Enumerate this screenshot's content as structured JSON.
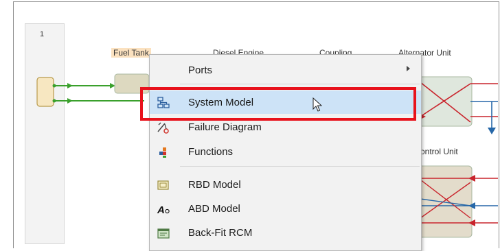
{
  "diagram": {
    "lane_number": "1",
    "blocks": {
      "fuel_tank": "Fuel Tank",
      "diesel_engine": "Diesel Engine",
      "coupling": "Coupling",
      "alternator_unit": "Alternator Unit",
      "control_unit": "ontrol Unit"
    },
    "colors": {
      "green": "#3aa02c",
      "red": "#c9242c",
      "blue": "#2667a8"
    }
  },
  "context_menu": {
    "items": [
      {
        "label": "Ports",
        "icon": "none",
        "has_submenu": true
      },
      {
        "label": "System Model",
        "icon": "system-model-icon",
        "hovered": true
      },
      {
        "label": "Failure Diagram",
        "icon": "failure-diagram-icon"
      },
      {
        "label": "Functions",
        "icon": "functions-icon"
      },
      {
        "label": "RBD Model",
        "icon": "rbd-model-icon"
      },
      {
        "label": "ABD Model",
        "icon": "abd-model-icon"
      },
      {
        "label": "Back-Fit RCM",
        "icon": "back-fit-rcm-icon"
      }
    ]
  },
  "annotation": {
    "highlight_color": "#e8121c",
    "highlighted_item": "System Model"
  }
}
